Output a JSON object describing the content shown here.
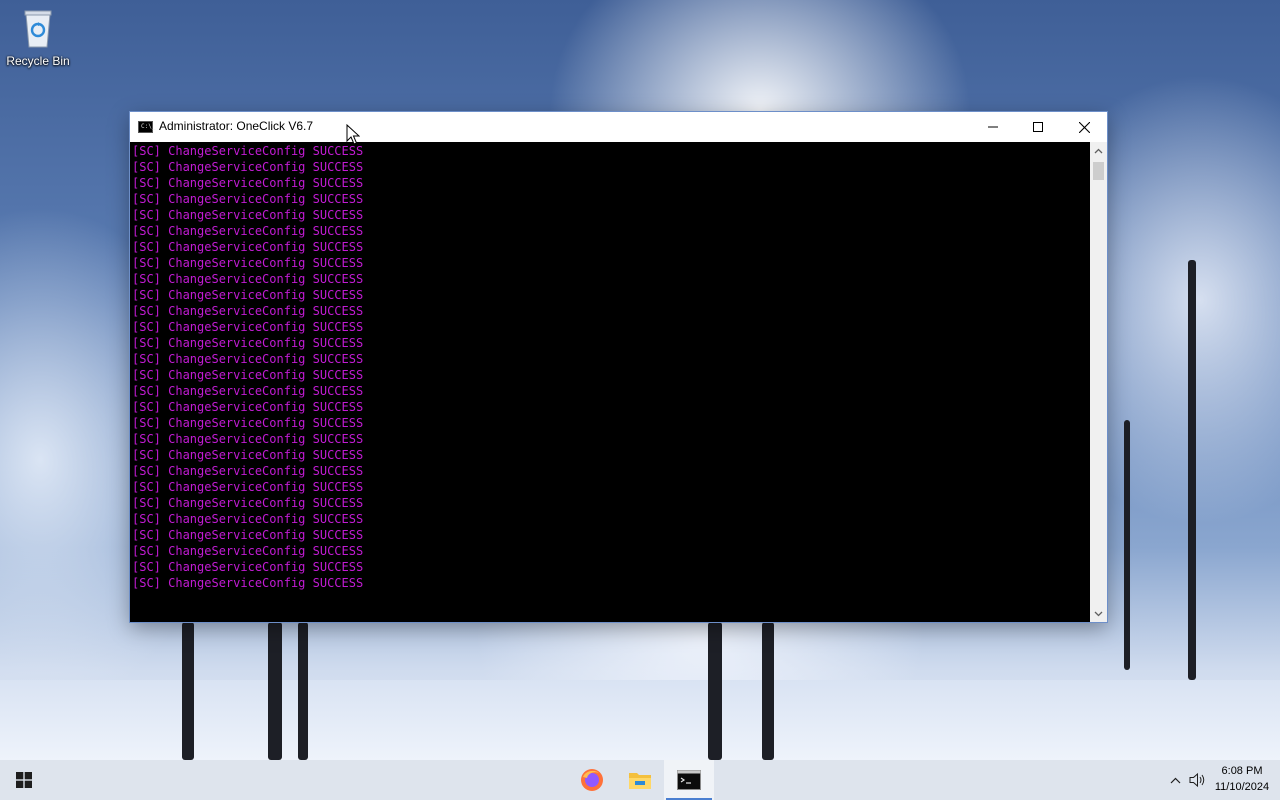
{
  "desktop": {
    "icons": [
      {
        "label": "Recycle Bin",
        "icon": "recycle-bin-icon"
      }
    ]
  },
  "window": {
    "title": "Administrator:  OneClick V6.7",
    "icon": "console-icon",
    "controls": [
      "minimize-icon",
      "maximize-icon",
      "close-icon"
    ],
    "console_color": "#c21bd4",
    "lines": [
      "[SC] ChangeServiceConfig SUCCESS",
      "[SC] ChangeServiceConfig SUCCESS",
      "[SC] ChangeServiceConfig SUCCESS",
      "[SC] ChangeServiceConfig SUCCESS",
      "[SC] ChangeServiceConfig SUCCESS",
      "[SC] ChangeServiceConfig SUCCESS",
      "[SC] ChangeServiceConfig SUCCESS",
      "[SC] ChangeServiceConfig SUCCESS",
      "[SC] ChangeServiceConfig SUCCESS",
      "[SC] ChangeServiceConfig SUCCESS",
      "[SC] ChangeServiceConfig SUCCESS",
      "[SC] ChangeServiceConfig SUCCESS",
      "[SC] ChangeServiceConfig SUCCESS",
      "[SC] ChangeServiceConfig SUCCESS",
      "[SC] ChangeServiceConfig SUCCESS",
      "[SC] ChangeServiceConfig SUCCESS",
      "[SC] ChangeServiceConfig SUCCESS",
      "[SC] ChangeServiceConfig SUCCESS",
      "[SC] ChangeServiceConfig SUCCESS",
      "[SC] ChangeServiceConfig SUCCESS",
      "[SC] ChangeServiceConfig SUCCESS",
      "[SC] ChangeServiceConfig SUCCESS",
      "[SC] ChangeServiceConfig SUCCESS",
      "[SC] ChangeServiceConfig SUCCESS",
      "[SC] ChangeServiceConfig SUCCESS",
      "[SC] ChangeServiceConfig SUCCESS",
      "[SC] ChangeServiceConfig SUCCESS",
      "[SC] ChangeServiceConfig SUCCESS"
    ]
  },
  "taskbar": {
    "apps": [
      "firefox-icon",
      "file-explorer-icon",
      "command-prompt-icon"
    ],
    "active_app": "command-prompt-icon",
    "accent_color": "#4a7fd1",
    "tray": {
      "time": "6:08 PM",
      "date": "11/10/2024"
    }
  }
}
